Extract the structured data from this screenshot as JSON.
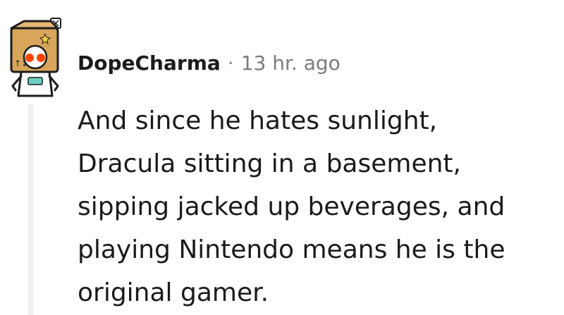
{
  "comment": {
    "username": "DopeCharma",
    "separator": "·",
    "timestamp": "13 hr. ago",
    "body_lines": [
      "And since he hates sunlight,",
      "Dracula sitting in a basement,",
      "sipping jacked up beverages, and",
      "playing Nintendo means he is the",
      "original gamer."
    ],
    "avatar": "snoo-box-robot-avatar"
  },
  "colors": {
    "username": "#1c1c1c",
    "meta_gray": "#7c7c7c",
    "body_text": "#1a1a1b",
    "thread_line": "#edeff1",
    "avatar_box": "#d9a55b",
    "avatar_eye": "#ff4500"
  }
}
